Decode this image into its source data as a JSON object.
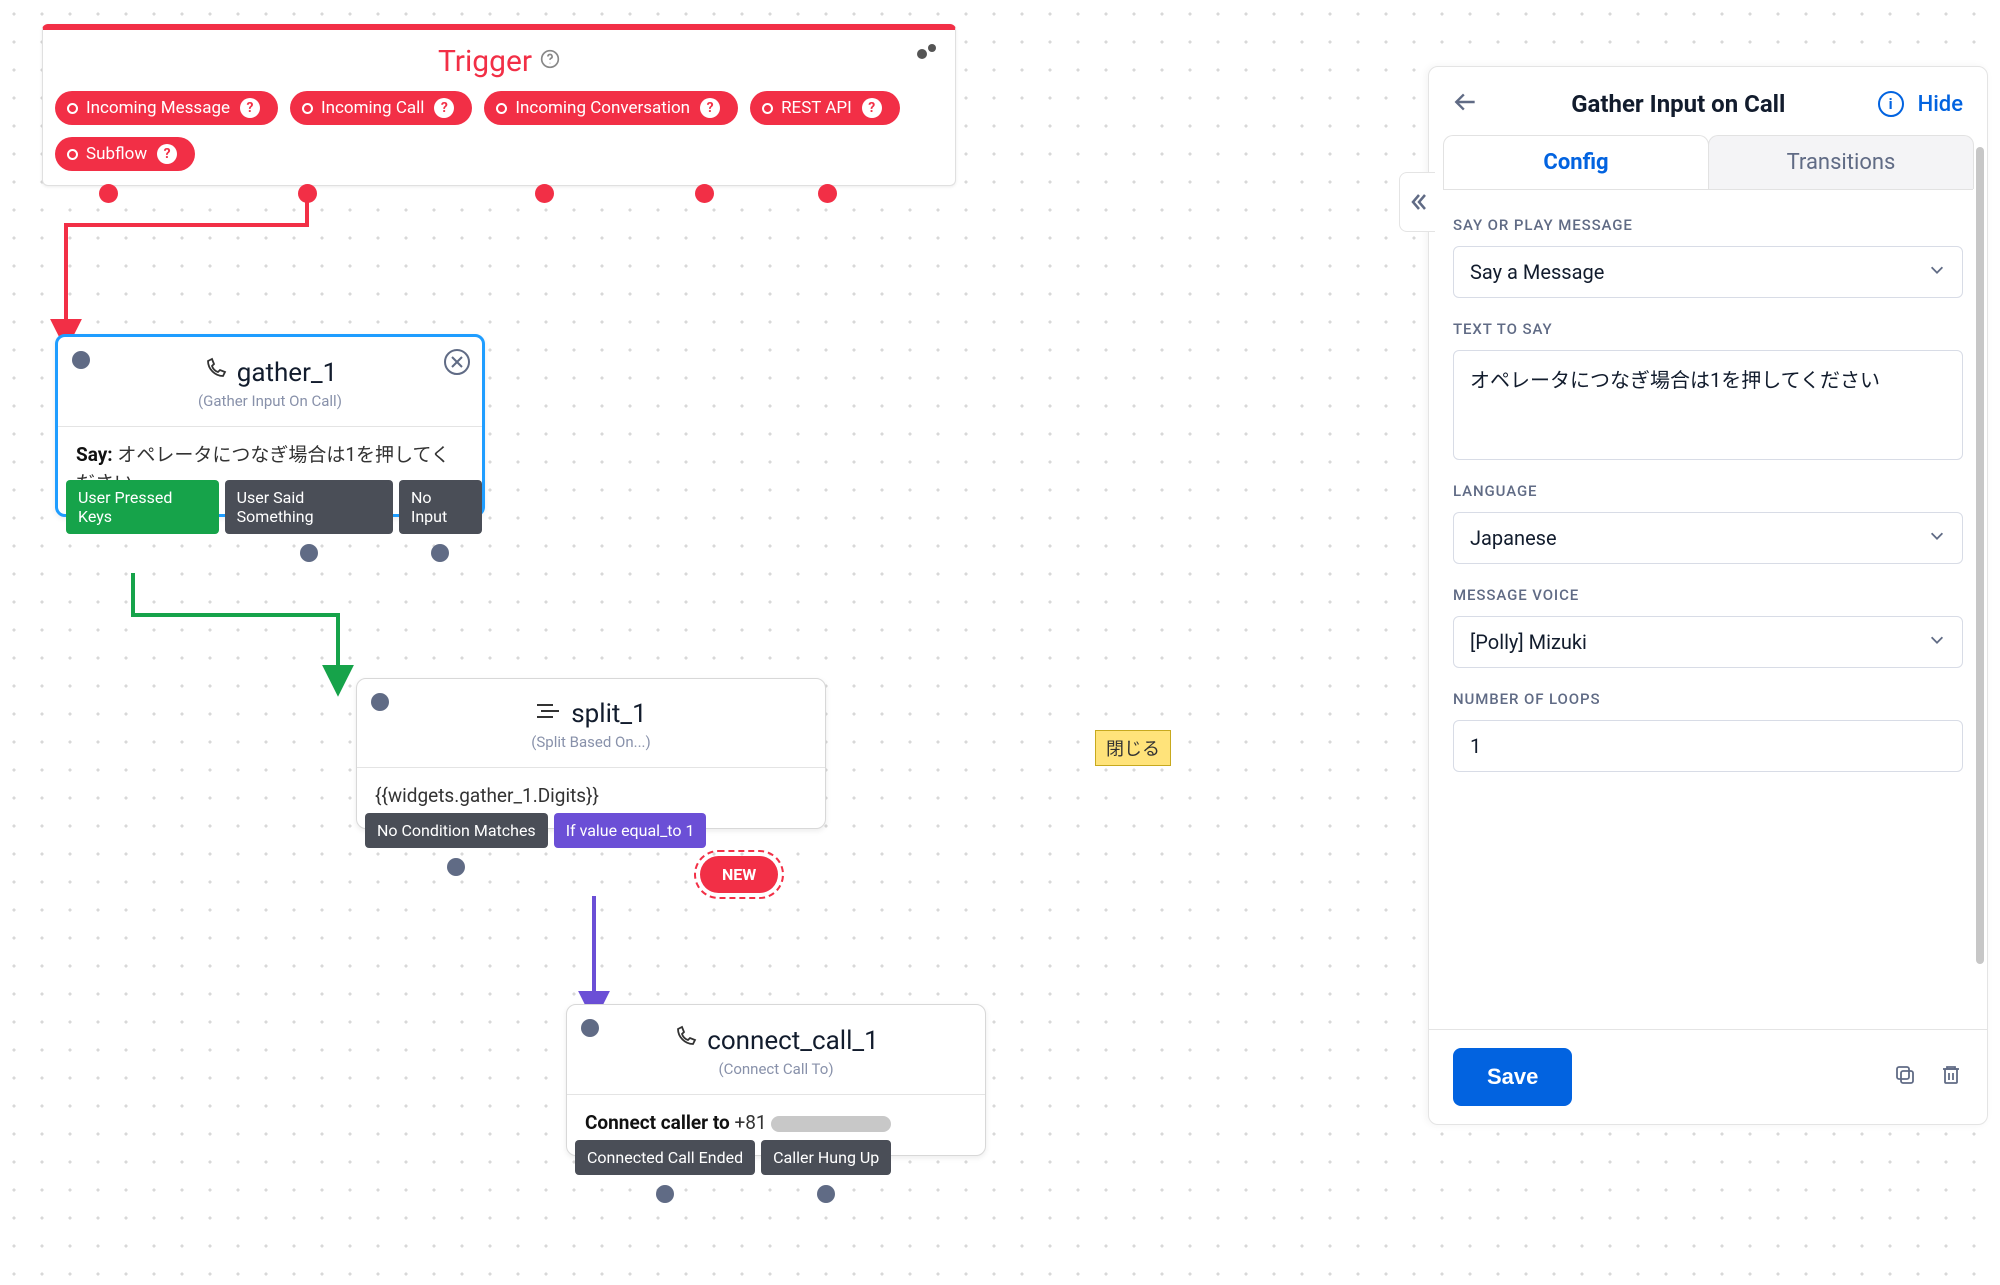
{
  "trigger": {
    "title": "Trigger",
    "events": [
      "Incoming Message",
      "Incoming Call",
      "Incoming Conversation",
      "REST API",
      "Subflow"
    ]
  },
  "gather": {
    "title": "gather_1",
    "subtitle": "(Gather Input On Call)",
    "say_label": "Say:",
    "say_text": "オペレータにつなぎ場合は1を押してください",
    "outs": [
      "User Pressed Keys",
      "User Said Something",
      "No Input"
    ]
  },
  "split": {
    "title": "split_1",
    "subtitle": "(Split Based On...)",
    "expr": "{{widgets.gather_1.Digits}}",
    "outs": [
      "No Condition Matches",
      "If value equal_to 1"
    ],
    "new_label": "NEW"
  },
  "connect": {
    "title": "connect_call_1",
    "subtitle": "(Connect Call To)",
    "line_label": "Connect caller to",
    "number_prefix": "+81",
    "outs": [
      "Connected Call Ended",
      "Caller Hung Up"
    ]
  },
  "close_label": "閉じる",
  "panel": {
    "title": "Gather Input on Call",
    "hide": "Hide",
    "tabs": {
      "config": "Config",
      "transitions": "Transitions"
    },
    "labels": {
      "say_or_play": "SAY OR PLAY MESSAGE",
      "text_to_say": "TEXT TO SAY",
      "language": "LANGUAGE",
      "voice": "MESSAGE VOICE",
      "loops": "NUMBER OF LOOPS"
    },
    "values": {
      "say_or_play": "Say a Message",
      "text_to_say": "オペレータにつなぎ場合は1を押してください",
      "language": "Japanese",
      "voice": "[Polly] Mizuki",
      "loops": "1"
    },
    "save": "Save"
  }
}
